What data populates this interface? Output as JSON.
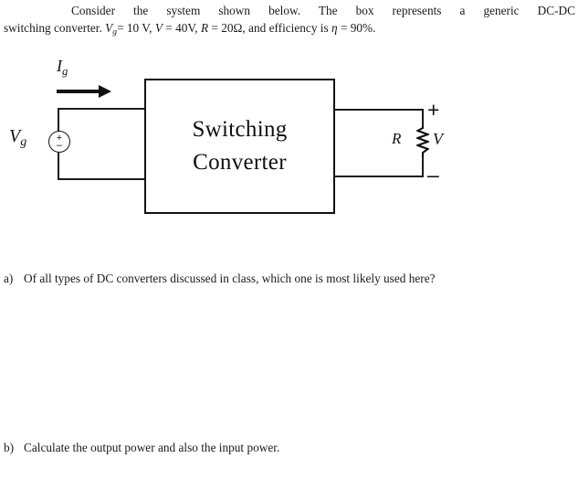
{
  "problem": {
    "line1": "Consider the system shown below. The box represents a generic DC-DC",
    "line2_prefix": "switching converter.",
    "vg_symbol": "V",
    "vg_sub": "g",
    "vg_value": "= 10 V,",
    "v_symbol": "V",
    "v_value": "= 40V,",
    "r_symbol": "R",
    "r_value": "= 20Ω,",
    "efficiency_prefix": "and efficiency is",
    "eta_symbol": "η",
    "eta_value": "= 90%."
  },
  "circuit": {
    "box_line1": "Switching",
    "box_line2": "Converter",
    "source_label": "V",
    "source_sub": "g",
    "source_plus": "+",
    "source_minus": "–",
    "current_label": "I",
    "current_sub": "g",
    "resistor_label": "R",
    "output_voltage_label": "V",
    "output_plus": "+",
    "output_minus": "–",
    "wire_color": "#1b1b1b",
    "box_border_color": "#111111"
  },
  "questions": [
    {
      "marker": "a)",
      "text": "Of all types of DC converters discussed in class, which one is most likely used here?"
    },
    {
      "marker": "b)",
      "text": "Calculate the output power and also the input power."
    }
  ]
}
